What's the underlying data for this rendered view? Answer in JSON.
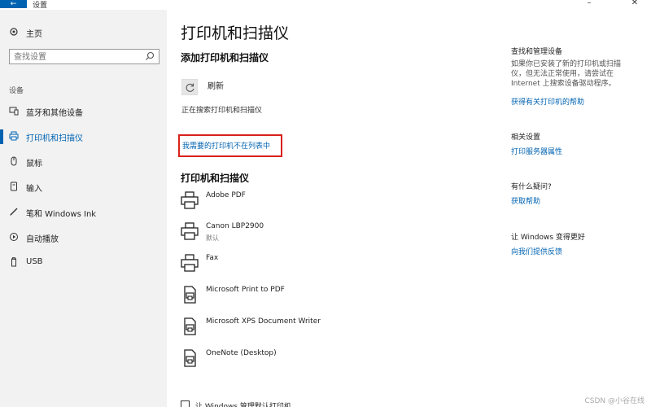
{
  "titlebar": {
    "app_title": "设置",
    "back_icon": "back-arrow-icon",
    "minimize_glyph": "–",
    "close_glyph": "✕"
  },
  "sidebar": {
    "home_label": "主页",
    "search_placeholder": "查找设置",
    "section_label": "设备",
    "items": [
      {
        "label": "蓝牙和其他设备",
        "icon": "bluetooth-icon",
        "active": false
      },
      {
        "label": "打印机和扫描仪",
        "icon": "printer-icon",
        "active": true
      },
      {
        "label": "鼠标",
        "icon": "mouse-icon",
        "active": false
      },
      {
        "label": "输入",
        "icon": "keyboard-icon",
        "active": false
      },
      {
        "label": "笔和 Windows Ink",
        "icon": "pen-icon",
        "active": false
      },
      {
        "label": "自动播放",
        "icon": "autoplay-icon",
        "active": false
      },
      {
        "label": "USB",
        "icon": "usb-icon",
        "active": false
      }
    ]
  },
  "main": {
    "page_title": "打印机和扫描仪",
    "add_heading": "添加打印机和扫描仪",
    "refresh_label": "刷新",
    "searching_text": "正在搜索打印机和扫描仪",
    "not_listed_link": "我需要的打印机不在列表中",
    "list_heading": "打印机和扫描仪",
    "printers": [
      {
        "name": "Adobe PDF",
        "status": "",
        "icon": "printer-icon"
      },
      {
        "name": "Canon LBP2900",
        "status": "默认",
        "icon": "printer-icon"
      },
      {
        "name": "Fax",
        "status": "",
        "icon": "printer-icon"
      },
      {
        "name": "Microsoft Print to PDF",
        "status": "",
        "icon": "document-printer-icon"
      },
      {
        "name": "Microsoft XPS Document Writer",
        "status": "",
        "icon": "document-printer-icon"
      },
      {
        "name": "OneNote (Desktop)",
        "status": "",
        "icon": "document-printer-icon"
      }
    ],
    "bottom_checkbox_label": "让 Windows 管理默认打印机"
  },
  "right_panel": {
    "find_heading": "查找和管理设备",
    "find_text": "如果你已安装了新的打印机或扫描仪，但无法正常使用，请尝试在 Internet 上搜索设备驱动程序。",
    "find_link": "获得有关打印机的帮助",
    "related_heading": "相关设置",
    "related_link": "打印服务器属性",
    "question_heading": "有什么疑问?",
    "question_link": "获取帮助",
    "improve_heading": "让 Windows 变得更好",
    "improve_link": "向我们提供反馈"
  },
  "watermark": "CSDN @小谷在线",
  "colors": {
    "accent": "#0063b1",
    "highlight_box": "#d9201a",
    "sidebar_bg": "#f2f2f2"
  }
}
